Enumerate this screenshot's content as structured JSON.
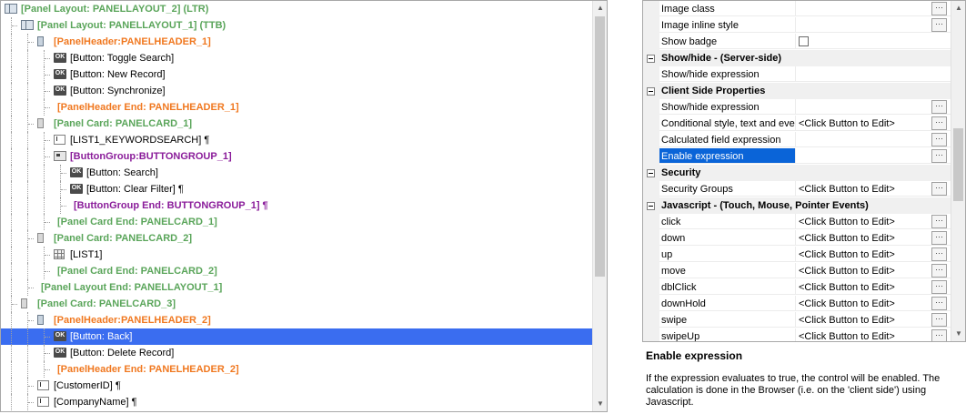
{
  "tree": {
    "rows": [
      {
        "label": "[Panel Layout: PANELLAYOUT_2] (LTR)",
        "style": "green",
        "icon": "layout",
        "icon_name": "panel-layout-icon",
        "indent": 0
      },
      {
        "label": "[Panel Layout: PANELLAYOUT_1] (TTB)",
        "style": "green",
        "icon": "layout",
        "icon_name": "panel-layout-icon",
        "indent": 1
      },
      {
        "label": "[PanelHeader:PANELHEADER_1]",
        "style": "orange",
        "icon": "header",
        "icon_name": "panel-header-icon",
        "indent": 2
      },
      {
        "label": "[Button: Toggle Search]",
        "style": "plain",
        "icon": "ok",
        "icon_name": "button-icon",
        "indent": 3
      },
      {
        "label": "[Button: New Record]",
        "style": "plain",
        "icon": "ok",
        "icon_name": "button-icon",
        "indent": 3
      },
      {
        "label": "[Button: Synchronize]",
        "style": "plain",
        "icon": "ok",
        "icon_name": "button-icon",
        "indent": 3
      },
      {
        "label": "[PanelHeader End: PANELHEADER_1]",
        "style": "orange",
        "icon": "none",
        "indent": 3
      },
      {
        "label": "[Panel Card: PANELCARD_1]",
        "style": "green",
        "icon": "card",
        "icon_name": "panel-card-icon",
        "indent": 2
      },
      {
        "label": "[LIST1_KEYWORDSEARCH] ¶",
        "style": "plain",
        "icon": "textbox",
        "icon_name": "textbox-icon",
        "indent": 3
      },
      {
        "label": "[ButtonGroup:BUTTONGROUP_1]",
        "style": "purple",
        "icon": "btngroup",
        "icon_name": "button-group-icon",
        "indent": 3
      },
      {
        "label": "[Button: Search]",
        "style": "plain",
        "icon": "ok",
        "icon_name": "button-icon",
        "indent": 4
      },
      {
        "label": "[Button: Clear Filter] ¶",
        "style": "plain",
        "icon": "ok",
        "icon_name": "button-icon",
        "indent": 4
      },
      {
        "label": "[ButtonGroup End: BUTTONGROUP_1] ¶",
        "style": "purple",
        "icon": "none",
        "indent": 4
      },
      {
        "label": "[Panel Card End: PANELCARD_1]",
        "style": "green",
        "icon": "none",
        "indent": 3
      },
      {
        "label": "[Panel Card: PANELCARD_2]",
        "style": "green",
        "icon": "card",
        "icon_name": "panel-card-icon",
        "indent": 2
      },
      {
        "label": "[LIST1]",
        "style": "plain",
        "icon": "grid",
        "icon_name": "grid-icon",
        "indent": 3
      },
      {
        "label": "[Panel Card End: PANELCARD_2]",
        "style": "green",
        "icon": "none",
        "indent": 3
      },
      {
        "label": "[Panel Layout End: PANELLAYOUT_1]",
        "style": "green",
        "icon": "none",
        "indent": 2
      },
      {
        "label": "[Panel Card: PANELCARD_3]",
        "style": "green",
        "icon": "card",
        "icon_name": "panel-card-icon",
        "indent": 1
      },
      {
        "label": "[PanelHeader:PANELHEADER_2]",
        "style": "orange",
        "icon": "header",
        "icon_name": "panel-header-icon",
        "indent": 2
      },
      {
        "label": "[Button: Back]",
        "style": "plain",
        "icon": "ok",
        "icon_name": "button-icon",
        "indent": 3,
        "selected": true
      },
      {
        "label": "[Button: Delete Record]",
        "style": "plain",
        "icon": "ok",
        "icon_name": "button-icon",
        "indent": 3
      },
      {
        "label": "[PanelHeader End: PANELHEADER_2]",
        "style": "orange",
        "icon": "none",
        "indent": 3
      },
      {
        "label": "[CustomerID] ¶",
        "style": "plain",
        "icon": "textbox",
        "icon_name": "textbox-icon",
        "indent": 2
      },
      {
        "label": "[CompanyName] ¶",
        "style": "plain",
        "icon": "textbox",
        "icon_name": "textbox-icon",
        "indent": 2
      }
    ],
    "scroll_up_icon": "scroll-up-icon",
    "scroll_down_icon": "scroll-down-icon"
  },
  "properties": {
    "rows": [
      {
        "type": "prop",
        "name": "Image class",
        "value": "",
        "button": true
      },
      {
        "type": "prop",
        "name": "Image inline style",
        "value": "",
        "button": true
      },
      {
        "type": "prop",
        "name": "Show badge",
        "value": "",
        "checkbox": true,
        "checked": false
      },
      {
        "type": "cat",
        "name": "Show/hide - (Server-side)"
      },
      {
        "type": "prop",
        "name": "Show/hide expression",
        "value": ""
      },
      {
        "type": "cat",
        "name": "Client Side Properties"
      },
      {
        "type": "prop",
        "name": "Show/hide expression",
        "value": "",
        "button": true
      },
      {
        "type": "prop",
        "name": "Conditional style, text and eve",
        "value": "<Click Button to Edit>",
        "button": true
      },
      {
        "type": "prop",
        "name": "Calculated field expression",
        "value": "",
        "button": true
      },
      {
        "type": "prop",
        "name": "Enable expression",
        "value": "",
        "button": true,
        "selected": true
      },
      {
        "type": "cat",
        "name": "Security"
      },
      {
        "type": "prop",
        "name": "Security Groups",
        "value": "<Click Button to Edit>",
        "button": true
      },
      {
        "type": "cat",
        "name": "Javascript - (Touch, Mouse, Pointer Events)"
      },
      {
        "type": "prop",
        "name": "click",
        "value": "<Click Button to Edit>",
        "button": true
      },
      {
        "type": "prop",
        "name": "down",
        "value": "<Click Button to Edit>",
        "button": true
      },
      {
        "type": "prop",
        "name": "up",
        "value": "<Click Button to Edit>",
        "button": true
      },
      {
        "type": "prop",
        "name": "move",
        "value": "<Click Button to Edit>",
        "button": true
      },
      {
        "type": "prop",
        "name": "dblClick",
        "value": "<Click Button to Edit>",
        "button": true
      },
      {
        "type": "prop",
        "name": "downHold",
        "value": "<Click Button to Edit>",
        "button": true
      },
      {
        "type": "prop",
        "name": "swipe",
        "value": "<Click Button to Edit>",
        "button": true
      },
      {
        "type": "prop",
        "name": "swipeUp",
        "value": "<Click Button to Edit>",
        "button": true
      }
    ],
    "edit_button_label": "···"
  },
  "description": {
    "title": "Enable expression",
    "text": "If the expression evaluates to true, the control will be enabled. The calculation is done in the Browser (i.e. on the 'client side') using Javascript."
  }
}
